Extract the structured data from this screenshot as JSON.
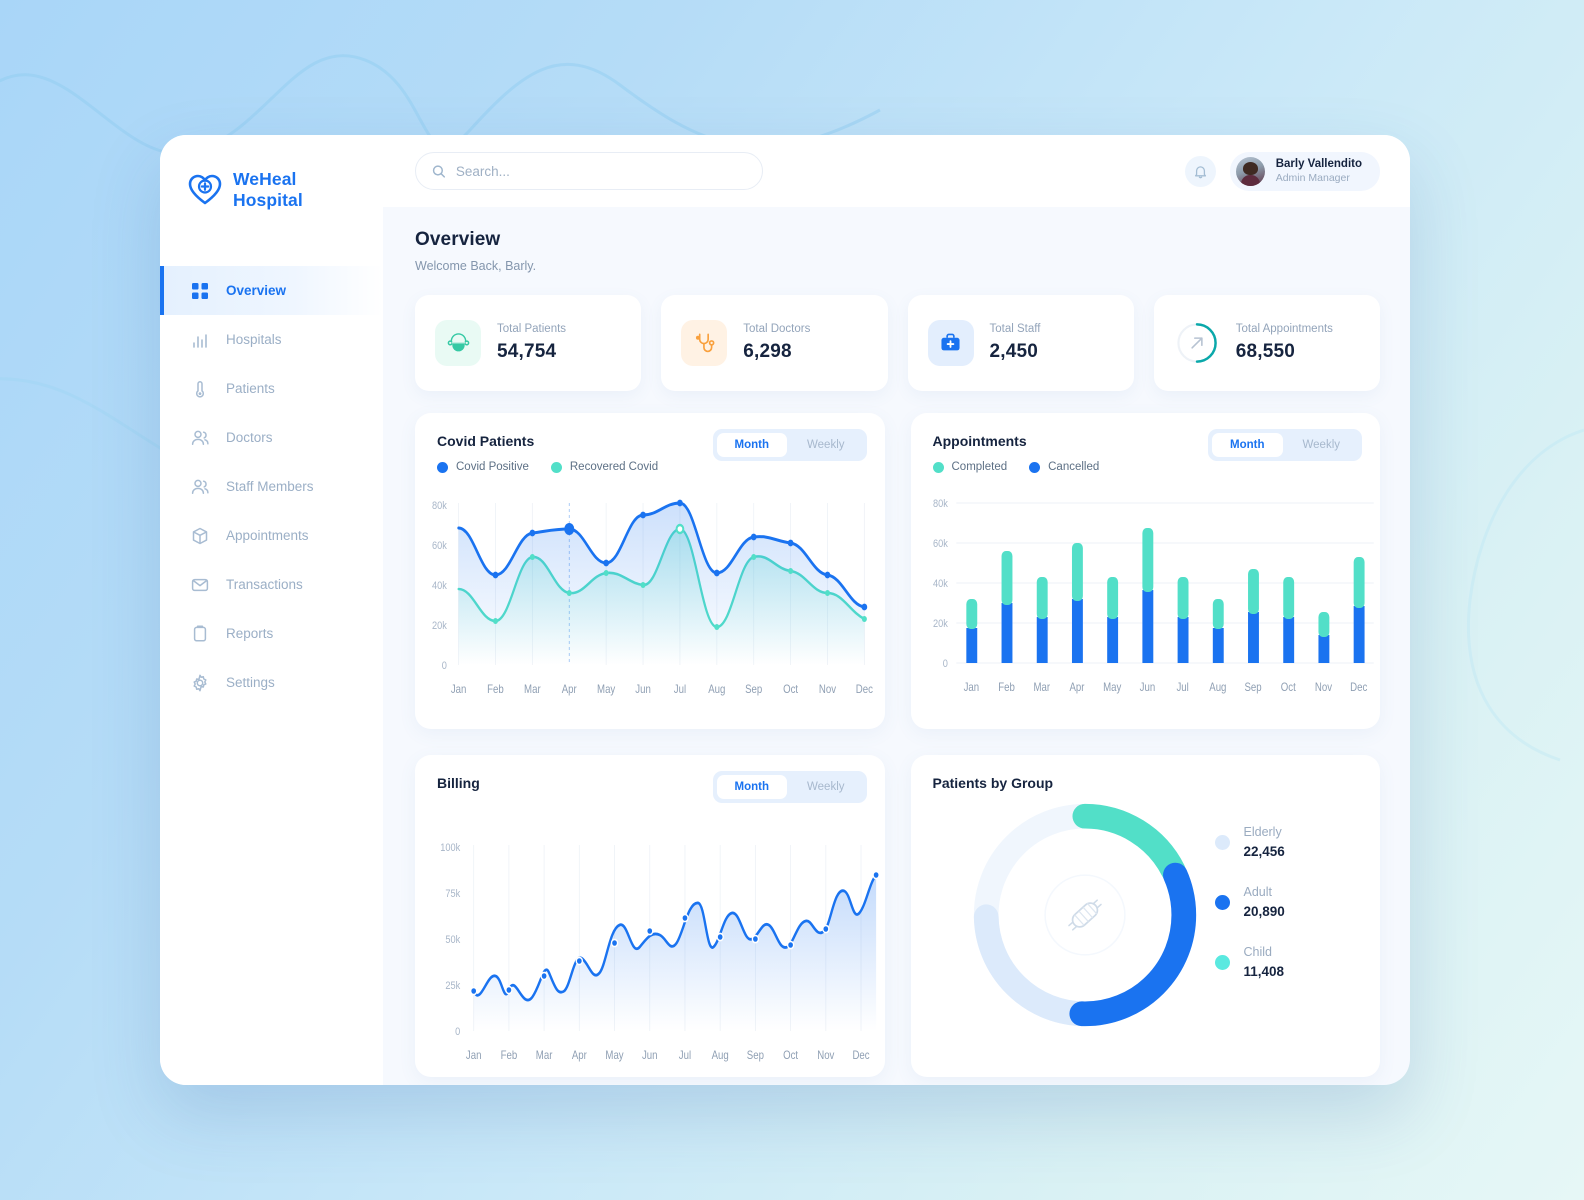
{
  "brand": {
    "line1": "WeHeal",
    "line2": "Hospital",
    "icon": "heart-plus-icon"
  },
  "sidebar": {
    "items": [
      {
        "label": "Overview",
        "icon": "grid-icon",
        "active": true
      },
      {
        "label": "Hospitals",
        "icon": "bar-chart-icon",
        "active": false
      },
      {
        "label": "Patients",
        "icon": "thermometer-icon",
        "active": false
      },
      {
        "label": "Doctors",
        "icon": "users-icon",
        "active": false
      },
      {
        "label": "Staff Members",
        "icon": "users-icon",
        "active": false
      },
      {
        "label": "Appointments",
        "icon": "box-icon",
        "active": false
      },
      {
        "label": "Transactions",
        "icon": "envelope-icon",
        "active": false
      },
      {
        "label": "Reports",
        "icon": "clipboard-icon",
        "active": false
      },
      {
        "label": "Settings",
        "icon": "gear-icon",
        "active": false
      }
    ]
  },
  "topbar": {
    "search_placeholder": "Search...",
    "search_value": "",
    "search_icon": "search-icon",
    "bell_icon": "bell-icon",
    "user_name": "Barly Vallendito",
    "user_role": "Admin Manager"
  },
  "header": {
    "title": "Overview",
    "subtitle": "Welcome Back, Barly."
  },
  "stats": [
    {
      "label": "Total Patients",
      "value": "54,754",
      "icon": "masked-face-icon",
      "icon_color": "#35c9a4",
      "bg": "#e9faf4"
    },
    {
      "label": "Total Doctors",
      "value": "6,298",
      "icon": "stethoscope-icon",
      "icon_color": "#f9a03c",
      "bg": "#fff2e4"
    },
    {
      "label": "Total Staff",
      "value": "2,450",
      "icon": "medical-bag-icon",
      "icon_color": "#1a73f0",
      "bg": "#e3eefd"
    },
    {
      "label": "Total Appointments",
      "value": "68,550",
      "icon": "arrow-up-right-ring-icon",
      "icon_color": "#0aa8aa",
      "bg": "transparent"
    }
  ],
  "colors": {
    "blue": "#1a73f0",
    "teal": "#52dfc8",
    "cyan": "#5ae9e0",
    "lightblue": "#dceafb",
    "ring_teal": "#0aa8aa",
    "text_dark": "#16243f",
    "text_muted": "#9aabc0"
  },
  "covid_card": {
    "title": "Covid Patients",
    "toggle": {
      "options": [
        "Month",
        "Weekly"
      ],
      "selected": "Month"
    },
    "legend": [
      {
        "label": "Covid Positive",
        "color": "#1a73f0"
      },
      {
        "label": "Recovered Covid",
        "color": "#52dfc8"
      }
    ]
  },
  "appointments_card": {
    "title": "Appointments",
    "toggle": {
      "options": [
        "Month",
        "Weekly"
      ],
      "selected": "Month"
    },
    "legend": [
      {
        "label": "Completed",
        "color": "#52dfc8"
      },
      {
        "label": "Cancelled",
        "color": "#1a73f0"
      }
    ]
  },
  "billing_card": {
    "title": "Billing",
    "toggle": {
      "options": [
        "Month",
        "Weekly"
      ],
      "selected": "Month"
    }
  },
  "patients_group_card": {
    "title": "Patients by Group",
    "center_icon": "face-mask-icon",
    "groups": [
      {
        "label": "Elderly",
        "value": "22,456",
        "color": "#dceafb"
      },
      {
        "label": "Adult",
        "value": "20,890",
        "color": "#1a73f0"
      },
      {
        "label": "Child",
        "value": "11,408",
        "color": "#5ae9e0"
      }
    ]
  },
  "chart_data": [
    {
      "id": "covid-patients",
      "type": "line",
      "title": "Covid Patients",
      "xlabel": "",
      "ylabel": "",
      "ylim": [
        0,
        80000
      ],
      "yticks": [
        0,
        20000,
        40000,
        60000,
        80000
      ],
      "yticklabels": [
        "0",
        "20k",
        "40k",
        "60k",
        "80k"
      ],
      "grid": "vertical",
      "legend_position": "top-left",
      "categories": [
        "Jan",
        "Feb",
        "Mar",
        "Apr",
        "May",
        "Jun",
        "Jul",
        "Aug",
        "Sep",
        "Oct",
        "Nov",
        "Dec"
      ],
      "highlight": {
        "category": "Apr",
        "series": "Covid Positive",
        "value": 65000
      },
      "series": [
        {
          "name": "Covid Positive",
          "color": "#1a73f0",
          "values": [
            69000,
            45000,
            64000,
            65000,
            52000,
            72000,
            78000,
            46000,
            60000,
            62000,
            48000,
            31000
          ]
        },
        {
          "name": "Recovered Covid",
          "color": "#52dfc8",
          "values": [
            38000,
            26000,
            53000,
            38000,
            46000,
            41000,
            66000,
            20000,
            52000,
            50000,
            39000,
            26000
          ]
        }
      ]
    },
    {
      "id": "appointments",
      "type": "bar",
      "title": "Appointments",
      "stacked": true,
      "xlabel": "",
      "ylabel": "",
      "ylim": [
        0,
        80000
      ],
      "yticks": [
        0,
        20000,
        40000,
        60000,
        80000
      ],
      "yticklabels": [
        "0",
        "20k",
        "40k",
        "60k",
        "80k"
      ],
      "grid": "horizontal",
      "legend_position": "top-left",
      "categories": [
        "Jan",
        "Feb",
        "Mar",
        "Apr",
        "May",
        "Jun",
        "Jul",
        "Aug",
        "Sep",
        "Oct",
        "Nov",
        "Dec"
      ],
      "series": [
        {
          "name": "Cancelled",
          "color": "#1a73f0",
          "values": [
            17500,
            30000,
            23000,
            32000,
            23000,
            36500,
            23000,
            17500,
            25000,
            23000,
            14000,
            28000
          ]
        },
        {
          "name": "Completed",
          "color": "#52dfc8",
          "values": [
            14500,
            26000,
            20000,
            28000,
            20000,
            31000,
            20000,
            14500,
            22000,
            20000,
            11500,
            25000
          ]
        }
      ],
      "totals": [
        32000,
        56000,
        43000,
        60000,
        43000,
        67500,
        43000,
        32000,
        47000,
        43000,
        25500,
        53000
      ]
    },
    {
      "id": "billing",
      "type": "area",
      "title": "Billing",
      "xlabel": "",
      "ylabel": "",
      "ylim": [
        0,
        100000
      ],
      "yticks": [
        0,
        25000,
        50000,
        75000,
        100000
      ],
      "yticklabels": [
        "0",
        "25k",
        "50k",
        "75k",
        "100k"
      ],
      "grid": "vertical",
      "categories": [
        "Jan",
        "Feb",
        "Mar",
        "Apr",
        "May",
        "Jun",
        "Jul",
        "Aug",
        "Sep",
        "Oct",
        "Nov",
        "Dec"
      ],
      "series": [
        {
          "name": "Billing",
          "color": "#1a73f0",
          "values": [
            24000,
            24500,
            30000,
            39000,
            52000,
            60000,
            75000,
            69000,
            62000,
            65000,
            71000,
            86000
          ]
        }
      ]
    },
    {
      "id": "patients-by-group",
      "type": "pie",
      "title": "Patients by Group",
      "labels": [
        "Elderly",
        "Adult",
        "Child"
      ],
      "values": [
        22456,
        20890,
        11408
      ],
      "colors": [
        "#dceafb",
        "#1a73f0",
        "#5ae9e0"
      ],
      "legend_position": "right"
    }
  ]
}
